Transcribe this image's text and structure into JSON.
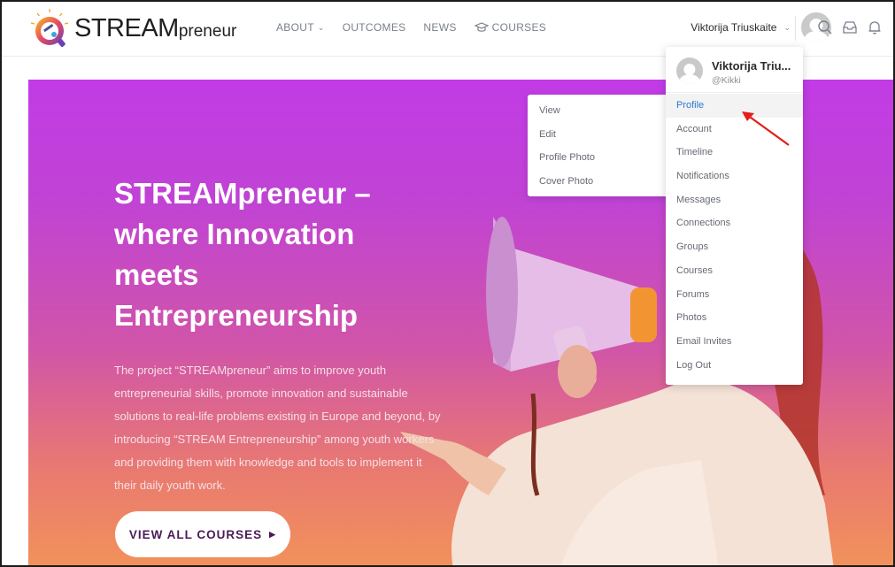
{
  "brand": {
    "name": "STREAM",
    "suffix": "preneur"
  },
  "nav": {
    "items": [
      {
        "label": "ABOUT",
        "has_dropdown": true,
        "icon": ""
      },
      {
        "label": "OUTCOMES",
        "has_dropdown": false,
        "icon": ""
      },
      {
        "label": "NEWS",
        "has_dropdown": false,
        "icon": ""
      },
      {
        "label": "COURSES",
        "has_dropdown": false,
        "icon": "graduation-cap-icon"
      }
    ]
  },
  "user": {
    "name": "Viktorija Triuskaite",
    "short_name": "Viktorija Triu...",
    "handle": "@Kikki"
  },
  "header_icons": [
    "search-icon",
    "inbox-icon",
    "bell-icon"
  ],
  "hero": {
    "title": "STREAMpreneur – where Innovation meets Entrepreneurship",
    "text": "The project “STREAMpreneur” aims to improve youth entrepreneurial skills, promote innovation and sustainable solutions to real-life problems existing in Europe and beyond, by introducing “STREAM Entrepreneurship” among youth workers and providing them with knowledge and tools to implement it their daily youth work.",
    "cta": "VIEW ALL COURSES"
  },
  "profile_submenu": [
    "View",
    "Edit",
    "Profile Photo",
    "Cover Photo"
  ],
  "user_menu": {
    "items": [
      "Profile",
      "Account",
      "Timeline",
      "Notifications",
      "Messages",
      "Connections",
      "Groups",
      "Courses",
      "Forums",
      "Photos",
      "Email Invites",
      "Log Out"
    ],
    "active": "Profile"
  },
  "colors": {
    "hero_top": "#c23be6",
    "hero_bottom": "#f2925a",
    "active_link": "#2a7ad3",
    "annotation": "#e0201b"
  }
}
